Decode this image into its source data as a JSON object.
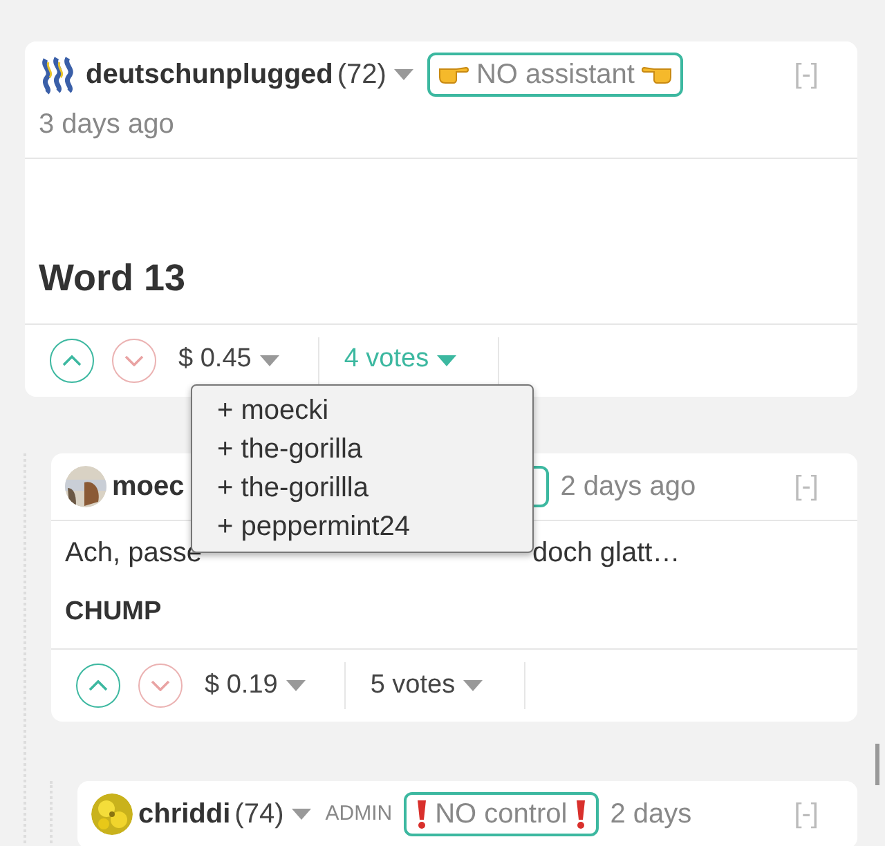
{
  "comments": [
    {
      "author": "deutschunplugged",
      "reputation": "(72)",
      "tag": {
        "kind": "text",
        "text": "NO assistant"
      },
      "time": "3 days ago",
      "collapse": "[-]",
      "body": [
        {
          "kind": "heading",
          "text": "Word 13"
        }
      ],
      "payout": "$ 0.45",
      "votes": "4 votes",
      "votes_open": true,
      "voters": [
        "+ moecki",
        "+ the-gorilla",
        "+ the-gorillla",
        "+ peppermint24"
      ],
      "replies": [
        {
          "author": "moec",
          "tag": {
            "kind": "covered"
          },
          "time": "2 days ago",
          "collapse": "[-]",
          "body": [
            {
              "kind": "text",
              "parts": [
                "Ach, passe",
                "doch glatt…"
              ]
            },
            {
              "kind": "caps",
              "text": "CHUMP"
            }
          ],
          "payout": "$ 0.19",
          "votes": "5 votes",
          "votes_open": false,
          "replies": [
            {
              "author": "chriddi",
              "reputation": "(74)",
              "role": "ADMIN",
              "tag": {
                "kind": "text",
                "text": "NO control"
              },
              "time": "2 days",
              "collapse": "[-]"
            }
          ]
        }
      ]
    }
  ]
}
